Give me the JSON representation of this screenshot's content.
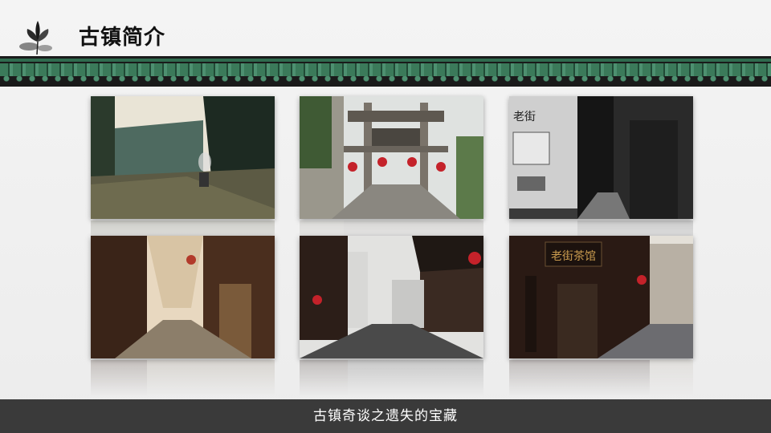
{
  "header": {
    "title": "古镇简介",
    "logo_icon": "lotus-ink-icon"
  },
  "gallery": {
    "photos": [
      {
        "subject": "old-street-sunlit-alley"
      },
      {
        "subject": "stone-archway-red-lanterns"
      },
      {
        "subject": "black-white-street-sign"
      },
      {
        "subject": "wooden-shopfront-lane"
      },
      {
        "subject": "rainy-street-red-lanterns"
      },
      {
        "subject": "teahouse-signboard-street"
      }
    ]
  },
  "footer": {
    "caption": "古镇奇谈之遗失的宝藏"
  },
  "colors": {
    "roof_green": "#3b7a5a",
    "footer_bg": "#3a3a3a",
    "background": "#f0f0f0"
  }
}
